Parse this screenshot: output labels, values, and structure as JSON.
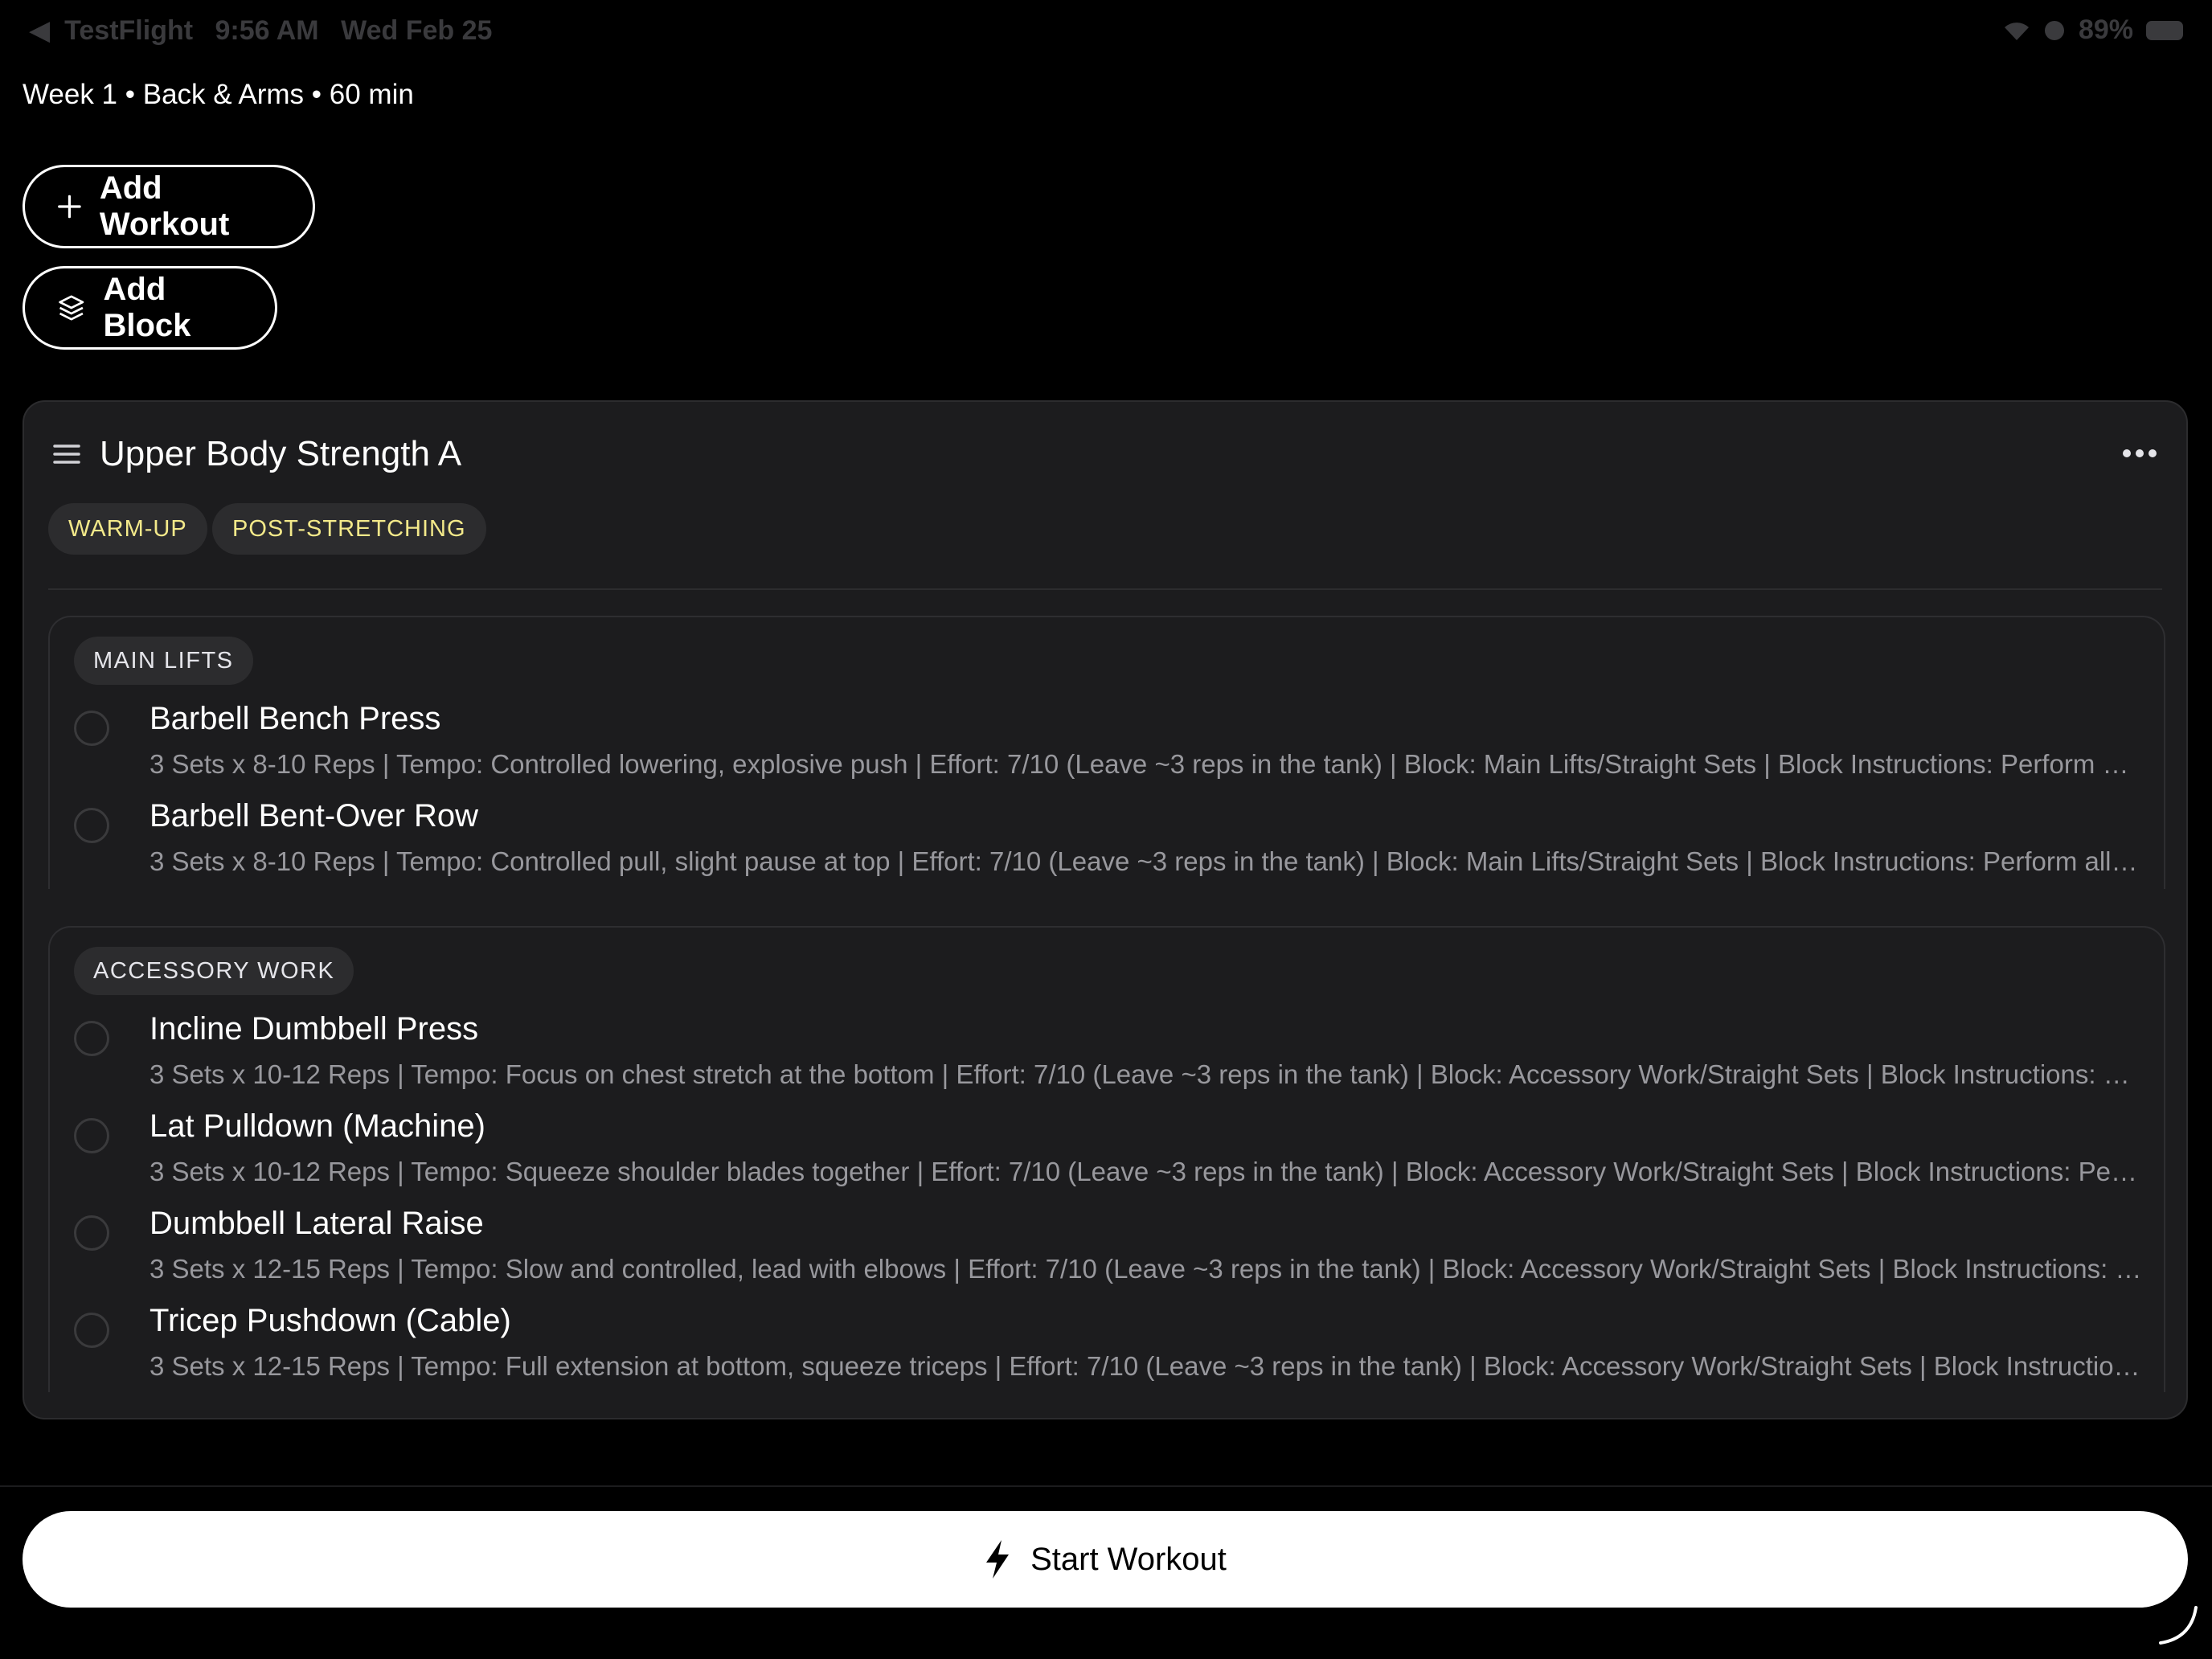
{
  "status_bar": {
    "back_app": "TestFlight",
    "time": "9:56 AM",
    "date": "Wed Feb 25",
    "battery": "89%"
  },
  "subtitle": "Week 1 • Back & Arms • 60 min",
  "actions": {
    "add_workout": "Add Workout",
    "add_block": "Add Block"
  },
  "workout": {
    "title": "Upper Body Strength A",
    "tags": [
      "WARM-UP",
      "POST-STRETCHING"
    ],
    "sections": [
      {
        "label": "MAIN LIFTS",
        "exercises": [
          {
            "name": "Barbell Bench Press",
            "detail": "3 Sets x 8-10 Reps | Tempo: Controlled lowering, explosive push | Effort: 7/10 (Leave ~3 reps in the tank) | Block: Main Lifts/Straight Sets | Block Instructions: Perform all se..."
          },
          {
            "name": "Barbell Bent-Over Row",
            "detail": "3 Sets x 8-10 Reps | Tempo: Controlled pull, slight pause at top | Effort: 7/10 (Leave ~3 reps in the tank) | Block: Main Lifts/Straight Sets | Block Instructions: Perform all sets..."
          }
        ]
      },
      {
        "label": "ACCESSORY WORK",
        "exercises": [
          {
            "name": "Incline Dumbbell Press",
            "detail": "3 Sets x 10-12 Reps | Tempo: Focus on chest stretch at the bottom | Effort: 7/10 (Leave ~3 reps in the tank) | Block: Accessory Work/Straight Sets | Block Instructions: Perfo..."
          },
          {
            "name": "Lat Pulldown (Machine)",
            "detail": "3 Sets x 10-12 Reps | Tempo: Squeeze shoulder blades together | Effort: 7/10 (Leave ~3 reps in the tank) | Block: Accessory Work/Straight Sets | Block Instructions: Perform..."
          },
          {
            "name": "Dumbbell Lateral Raise",
            "detail": "3 Sets x 12-15 Reps | Tempo: Slow and controlled, lead with elbows | Effort: 7/10 (Leave ~3 reps in the tank) | Block: Accessory Work/Straight Sets | Block Instructions: Perf..."
          },
          {
            "name": "Tricep Pushdown (Cable)",
            "detail": "3 Sets x 12-15 Reps | Tempo: Full extension at bottom, squeeze triceps | Effort: 7/10 (Leave ~3 reps in the tank) | Block: Accessory Work/Straight Sets | Block Instructions: P..."
          }
        ]
      }
    ]
  },
  "start_button": "Start Workout",
  "colors": {
    "background": "#000000",
    "card": "#1c1c1e",
    "tag_text": "#f3e98a",
    "muted_text": "#98989d"
  },
  "icons": [
    "plus-icon",
    "layers-icon",
    "drag-handle-icon",
    "more-icon",
    "bolt-icon",
    "wifi-icon"
  ]
}
